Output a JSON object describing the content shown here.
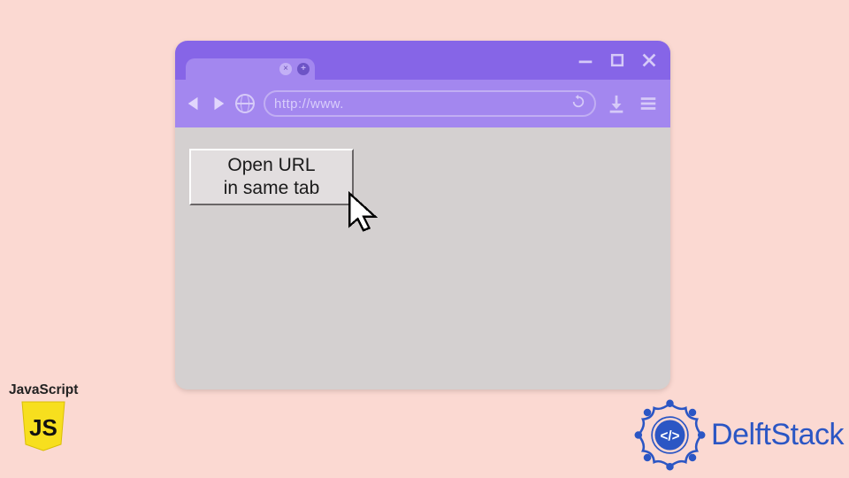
{
  "browser": {
    "url_placeholder": "http://www.",
    "tab": {
      "close_label": "×",
      "add_label": "+"
    },
    "controls": {
      "min": "—",
      "max": "☐",
      "close": "✕"
    }
  },
  "page": {
    "button": {
      "line1": "Open URL",
      "line2": "in same tab"
    }
  },
  "badges": {
    "js_label": "JavaScript",
    "js_text": "JS",
    "delftstack": "DelftStack"
  },
  "colors": {
    "bg": "#fbd9d2",
    "chrome": "#8665e7",
    "chrome_light": "#a387ef",
    "brand_blue": "#2b56c4",
    "js_yellow": "#f7df1e"
  }
}
